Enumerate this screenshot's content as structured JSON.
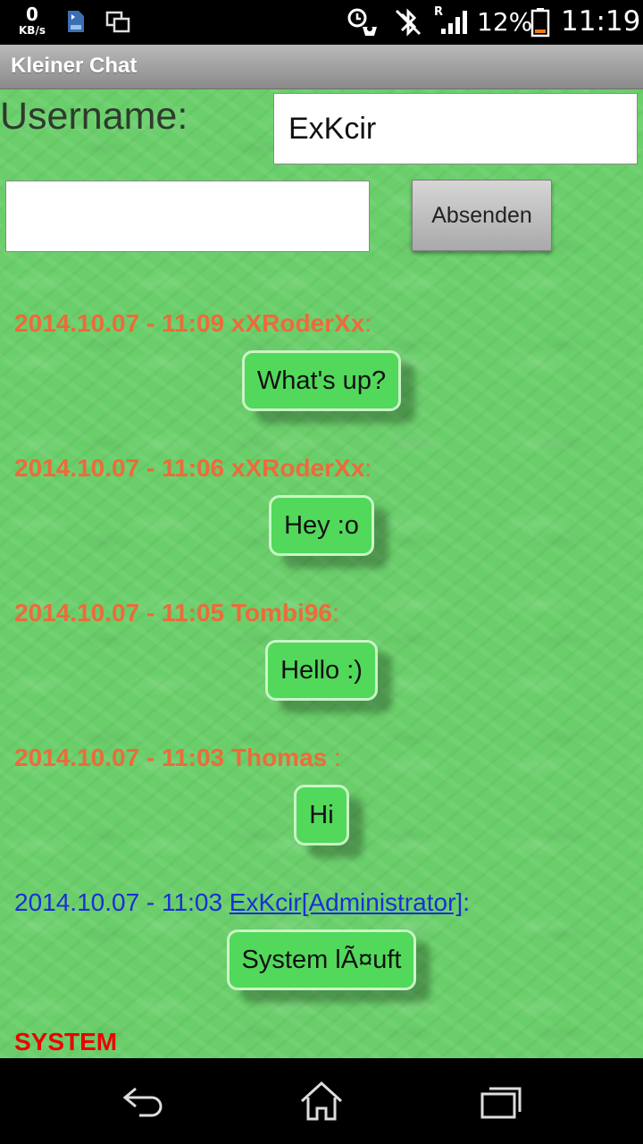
{
  "statusbar": {
    "speed_value": "0",
    "speed_unit": "KB/s",
    "network_indicator": "R",
    "battery_percent": "12%",
    "time": "11:19",
    "icons": [
      "sd-card-icon",
      "screen-cast-icon",
      "alarm-icon",
      "bluetooth-off-icon",
      "signal-icon",
      "battery-icon"
    ]
  },
  "app": {
    "title": "Kleiner Chat"
  },
  "form": {
    "username_label": "Username:",
    "username_value": "ExKcir",
    "message_value": "",
    "send_label": "Absenden"
  },
  "messages": [
    {
      "timestamp": "2014.10.07 - 11:09",
      "author": "xXRoderXx",
      "separator": ":",
      "text": "What's up?"
    },
    {
      "timestamp": "2014.10.07 - 11:06",
      "author": "xXRoderXx",
      "separator": ":",
      "text": "Hey :o"
    },
    {
      "timestamp": "2014.10.07 - 11:05",
      "author": "Tombi96",
      "separator": ":",
      "text": "Hello :)"
    },
    {
      "timestamp": "2014.10.07 - 11:03",
      "author": "Thomas",
      "separator": " :",
      "text": "Hi"
    },
    {
      "timestamp": "2014.10.07 - 11:03",
      "author": "ExKcir[Administrator]",
      "separator": ":",
      "text": "System lÃ¤uft"
    }
  ],
  "system_label": "SYSTEM",
  "colors": {
    "user_header": "#ec6b3b",
    "admin_header": "#1a2fd8",
    "bubble": "#52d85a",
    "background": "#6acf6a",
    "system": "#e00000"
  },
  "navbar": {
    "icons": [
      "back-icon",
      "home-icon",
      "recent-apps-icon"
    ]
  }
}
